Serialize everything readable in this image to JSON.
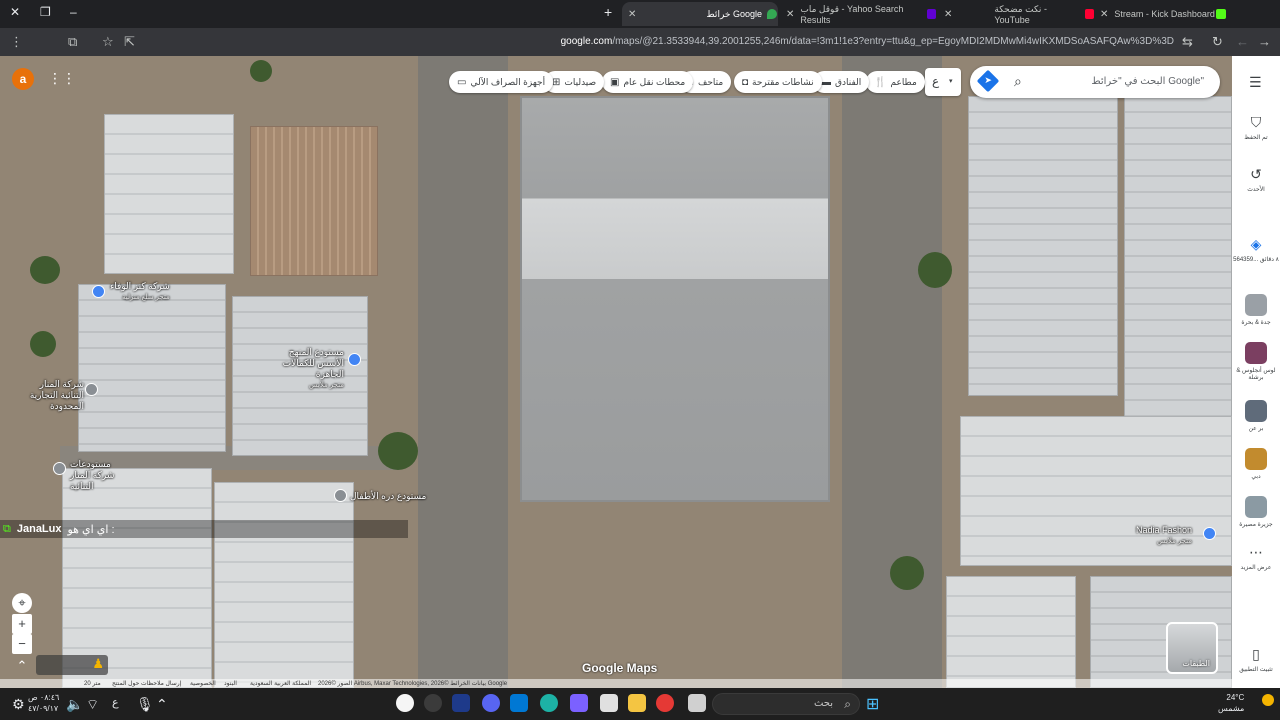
{
  "browser": {
    "tabs": [
      {
        "title": "Stream - Kick Dashboard",
        "color": "#53fc18"
      },
      {
        "title": "نكت مضحكة - YouTube",
        "color": "#ff0033"
      },
      {
        "title": "قوقل ماب - Yahoo Search Results",
        "color": "#6001d2"
      },
      {
        "title": "خرائط Google",
        "color": "#34a853",
        "active": true
      }
    ],
    "new_tab": "+",
    "url_host": "google.com",
    "url_path": "/maps/@21.3533944,39.2001255,246m/data=!3m1!1e3?entry=ttu&g_ep=EgoyMDI2MDMwMi4wIKXMDSoASAFQAw%3D%3D",
    "profile_initial": "a"
  },
  "maps": {
    "search_placeholder": "البحث في \"خرائط Google\"",
    "lang_button": "ع",
    "chips": [
      {
        "label": "مطاعم",
        "icon": "restaurant-icon"
      },
      {
        "label": "الفنادق",
        "icon": "hotel-icon"
      },
      {
        "label": "نشاطات مقترحة",
        "icon": "camera-icon"
      },
      {
        "label": "متاحف",
        "icon": "museum-icon"
      },
      {
        "label": "محطات نقل عام",
        "icon": "transit-icon"
      },
      {
        "label": "صيدليات",
        "icon": "pharmacy-icon"
      },
      {
        "label": "أجهزة الصراف الآلي",
        "icon": "atm-icon"
      }
    ],
    "user_initial": "a",
    "labels": [
      {
        "name": "شركة كنز الوفاء",
        "sub": "متجر سلع منزلية"
      },
      {
        "name": "مستودع المنهج الأسس للكمالات الجاهزة",
        "sub": "متجر ملابس"
      },
      {
        "name": "شركة المنار التنائية التجارية المحدودة",
        "sub": ""
      },
      {
        "name": "مستودعات شركة المنار التنائية",
        "sub": ""
      },
      {
        "name": "مستودع دره الأطفال",
        "sub": ""
      },
      {
        "name": "Nadia Fashon",
        "sub": "متجر ملابس"
      }
    ],
    "chat": {
      "name": "JanaLux",
      "message": "اي اي هو :"
    },
    "layers_label": "الطبقات",
    "brand": "Google Maps",
    "scale": "20 متر",
    "attribution": [
      "الصور ©2026 Airbus, Maxar Technologies, بيانات الخرائط ©2026 Google",
      "المملكة العربية السعودية",
      "البنود",
      "الخصوصية",
      "إرسال ملاحظات حول المنتج"
    ]
  },
  "rail": [
    {
      "label": "تم الحفظ",
      "icon": "bookmark-icon"
    },
    {
      "label": "الأحدث",
      "icon": "history-icon"
    },
    {
      "label": "564359... ٨ دقائق",
      "icon": "directions-icon"
    },
    {
      "label": "جدة & بحرة",
      "thumb": "#9aa0a6"
    },
    {
      "label": "لوس أنجلوس & برشلة",
      "thumb": "#7b3f61"
    },
    {
      "label": "بر عن",
      "thumb": "#5f6b7a"
    },
    {
      "label": "دبي",
      "thumb": "#c28b2e"
    },
    {
      "label": "جزيرة مصيرة",
      "thumb": "#8b9aa3"
    },
    {
      "label": "عرض المزيد",
      "icon": "more-icon"
    },
    {
      "label": "تثبيت التطبيق",
      "icon": "install-icon"
    }
  ],
  "taskbar": {
    "clock_time": "٠٨:٤٦ ص",
    "clock_date": "٤٧/٠٩/١٧",
    "lang": "ع",
    "search_label": "بحث",
    "weather_temp": "24°C",
    "weather_desc": "مشمس"
  },
  "colors": {
    "brand_blue": "#1a73e8",
    "user_orange": "#e8710a"
  }
}
